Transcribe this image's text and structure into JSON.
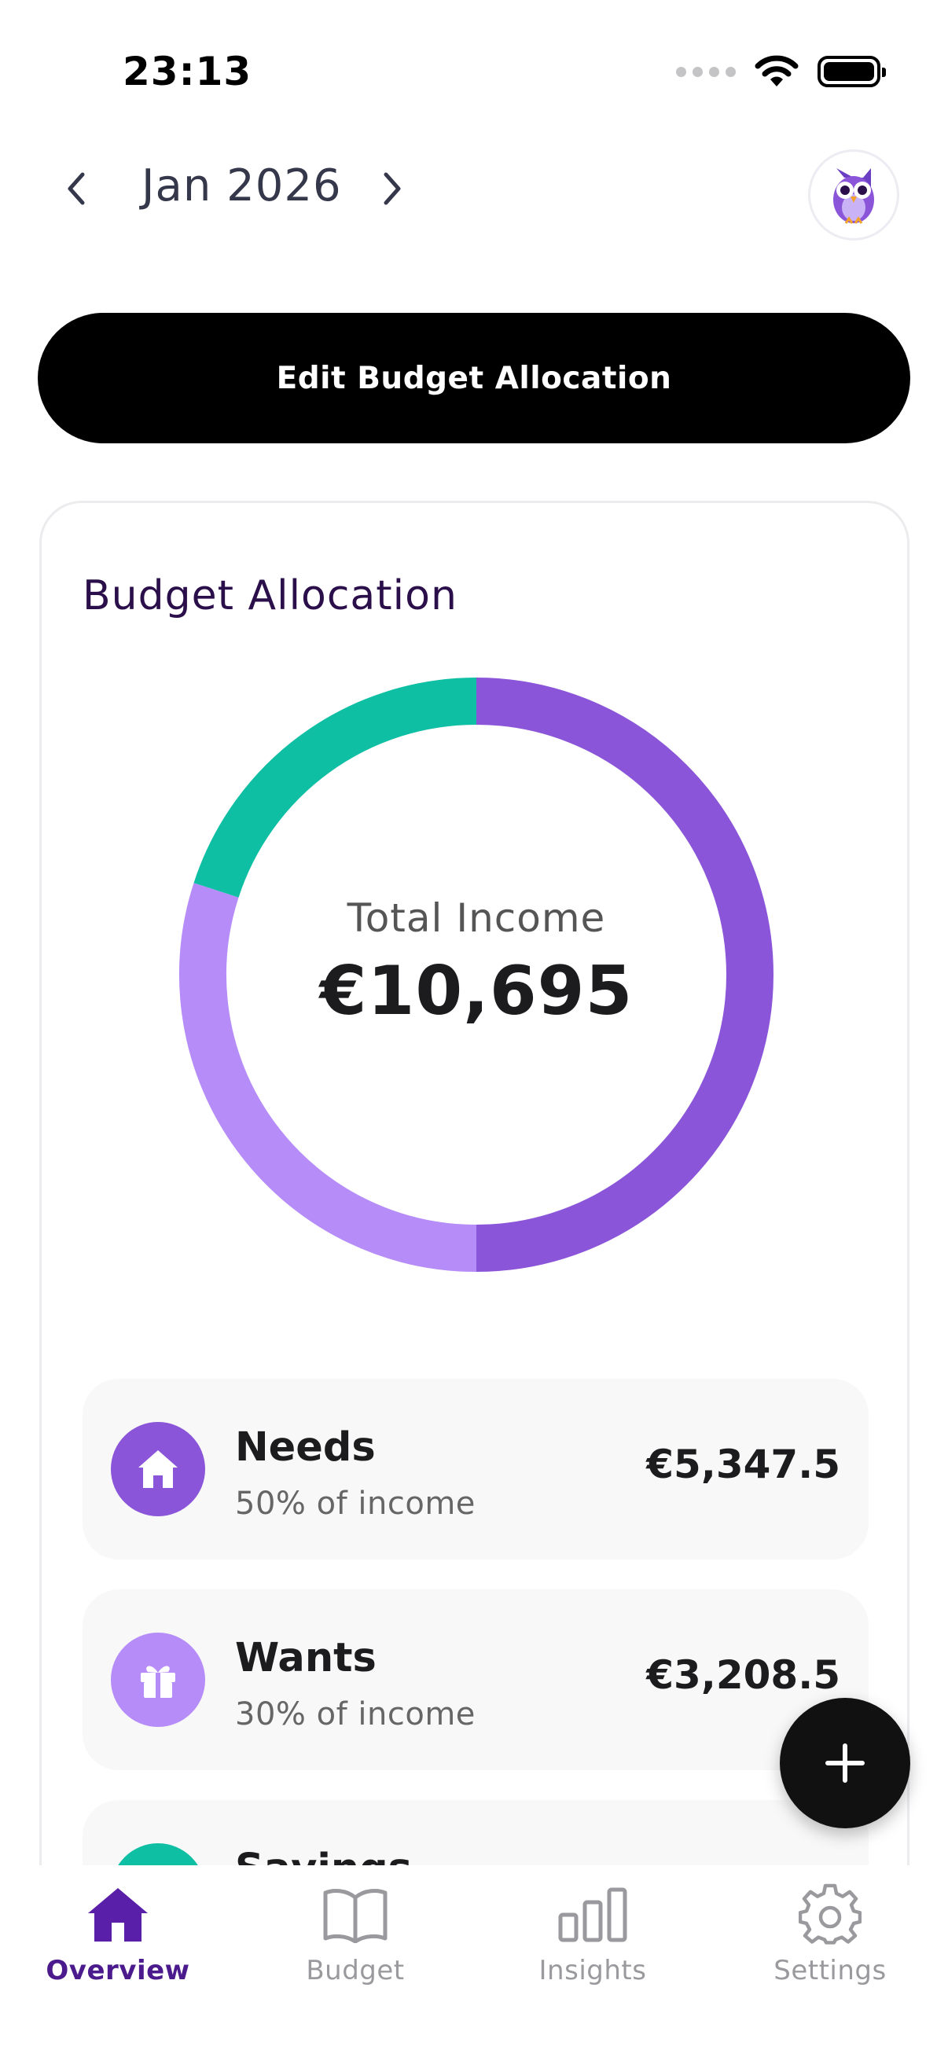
{
  "status_bar": {
    "time": "23:13"
  },
  "header": {
    "month": "Jan 2026",
    "prev_icon": "chevron-left-icon",
    "next_icon": "chevron-right-icon",
    "avatar_icon": "owl-icon"
  },
  "edit_button": {
    "label": "Edit Budget Allocation"
  },
  "allocation": {
    "title": "Budget Allocation",
    "total_label": "Total Income",
    "total_value": "€10,695"
  },
  "chart_data": {
    "type": "pie",
    "series": [
      {
        "name": "Needs",
        "value": 50,
        "color": "#8a55d9"
      },
      {
        "name": "Wants",
        "value": 30,
        "color": "#b58cf8"
      },
      {
        "name": "Savings",
        "value": 20,
        "color": "#0fbfa3"
      }
    ]
  },
  "categories": [
    {
      "name": "Needs",
      "subtitle": "50% of income",
      "amount": "€5,347.5",
      "icon": "home-icon",
      "color": "#8a55d9"
    },
    {
      "name": "Wants",
      "subtitle": "30% of income",
      "amount": "€3,208.5",
      "icon": "gift-icon",
      "color": "#b58cf8"
    },
    {
      "name": "Savings",
      "subtitle": "",
      "amount": "",
      "icon": "savings-icon",
      "color": "#0fbfa3"
    }
  ],
  "fab": {
    "icon": "plus-icon"
  },
  "tabs": [
    {
      "label": "Overview",
      "icon": "home-icon",
      "active": true
    },
    {
      "label": "Budget",
      "icon": "book-icon",
      "active": false
    },
    {
      "label": "Insights",
      "icon": "bar-chart-icon",
      "active": false
    },
    {
      "label": "Settings",
      "icon": "gear-icon",
      "active": false
    }
  ],
  "colors": {
    "accent": "#4b1a8c",
    "needs": "#8a55d9",
    "wants": "#b58cf8",
    "savings": "#0fbfa3"
  }
}
